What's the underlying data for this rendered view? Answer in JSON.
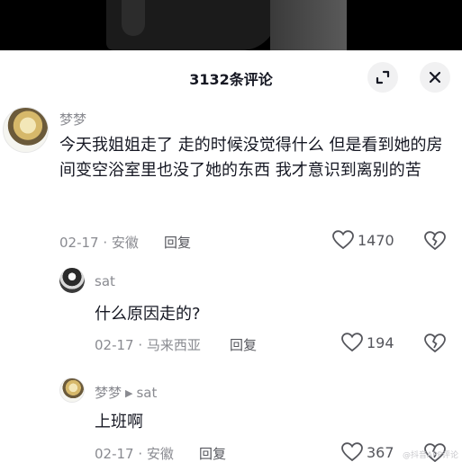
{
  "header": {
    "title": "3132条评论"
  },
  "comments": [
    {
      "user": "梦梦",
      "text": "今天我姐姐走了 走的时候没觉得什么 但是看到她的房间变空浴室里也没了她的东西 我才意识到离别的苦",
      "date": "02-17",
      "location": "安徽",
      "reply_label": "回复",
      "likes": "1470"
    },
    {
      "user": "sat",
      "text": "什么原因走的?",
      "date": "02-17",
      "location": "马来西亚",
      "reply_label": "回复",
      "likes": "194"
    },
    {
      "user": "梦梦",
      "reply_to": "sat",
      "text": "上班啊",
      "date": "02-17",
      "location": "安徽",
      "reply_label": "回复",
      "likes": "367"
    }
  ],
  "meta_separator": " · ",
  "watermark": "@抖音APP评论"
}
